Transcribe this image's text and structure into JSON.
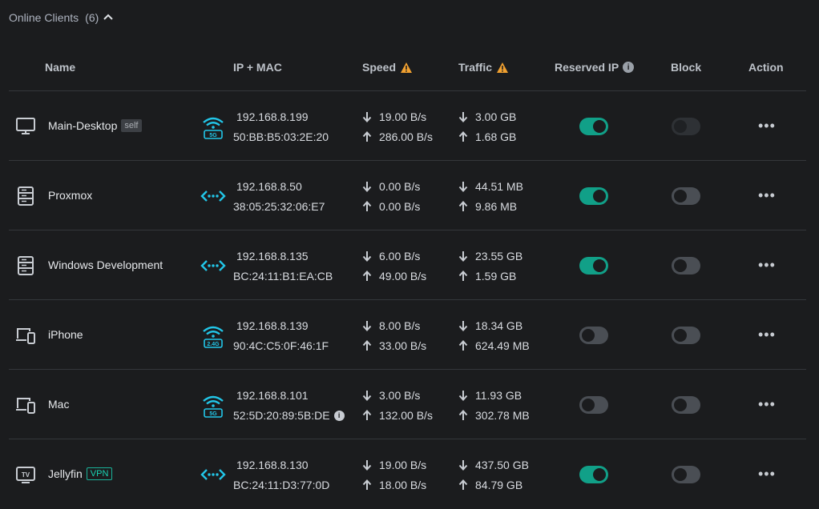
{
  "section": {
    "title": "Online Clients",
    "count": "(6)"
  },
  "columns": {
    "name": "Name",
    "ipmac": "IP + MAC",
    "speed": "Speed",
    "traffic": "Traffic",
    "reserved": "Reserved IP",
    "block": "Block",
    "action": "Action"
  },
  "action_label": "•••",
  "clients": [
    {
      "name": "Main-Desktop",
      "tag": "self",
      "icon": "desktop-icon",
      "conn": "wifi-5g-icon",
      "conn_label": "5G",
      "ip": "192.168.8.199",
      "mac": "50:BB:B5:03:2E:20",
      "down_speed": "19.00 B/s",
      "up_speed": "286.00 B/s",
      "down_traffic": "3.00 GB",
      "up_traffic": "1.68 GB",
      "reserved": true,
      "block": "disabled"
    },
    {
      "name": "Proxmox",
      "tag": "",
      "icon": "server-icon",
      "conn": "ethernet-icon",
      "ip": "192.168.8.50",
      "mac": "38:05:25:32:06:E7",
      "down_speed": "0.00 B/s",
      "up_speed": "0.00 B/s",
      "down_traffic": "44.51 MB",
      "up_traffic": "9.86 MB",
      "reserved": true,
      "block": "off"
    },
    {
      "name": "Windows Development",
      "tag": "",
      "icon": "server-icon",
      "conn": "ethernet-icon",
      "ip": "192.168.8.135",
      "mac": "BC:24:11:B1:EA:CB",
      "down_speed": "6.00 B/s",
      "up_speed": "49.00 B/s",
      "down_traffic": "23.55 GB",
      "up_traffic": "1.59 GB",
      "reserved": true,
      "block": "off"
    },
    {
      "name": "iPhone",
      "tag": "",
      "icon": "mobile-device-icon",
      "conn": "wifi-24g-icon",
      "conn_label": "2.4G",
      "ip": "192.168.8.139",
      "mac": "90:4C:C5:0F:46:1F",
      "down_speed": "8.00 B/s",
      "up_speed": "33.00 B/s",
      "down_traffic": "18.34 GB",
      "up_traffic": "624.49 MB",
      "reserved": false,
      "block": "off"
    },
    {
      "name": "Mac",
      "tag": "",
      "icon": "mobile-device-icon",
      "conn": "wifi-5g-icon",
      "conn_label": "5G",
      "ip": "192.168.8.101",
      "mac": "52:5D:20:89:5B:DE",
      "mac_info": true,
      "down_speed": "3.00 B/s",
      "up_speed": "132.00 B/s",
      "down_traffic": "11.93 GB",
      "up_traffic": "302.78 MB",
      "reserved": false,
      "block": "off"
    },
    {
      "name": "Jellyfin",
      "tag": "VPN",
      "icon": "tv-icon",
      "conn": "ethernet-icon",
      "ip": "192.168.8.130",
      "mac": "BC:24:11:D3:77:0D",
      "down_speed": "19.00 B/s",
      "up_speed": "18.00 B/s",
      "down_traffic": "437.50 GB",
      "up_traffic": "84.79 GB",
      "reserved": true,
      "block": "off"
    }
  ],
  "icon_labels": {
    "tv": "TV"
  },
  "colors": {
    "accent_teal": "#11a088",
    "warning": "#f0a030",
    "wifi_cyan": "#22c6e8"
  }
}
